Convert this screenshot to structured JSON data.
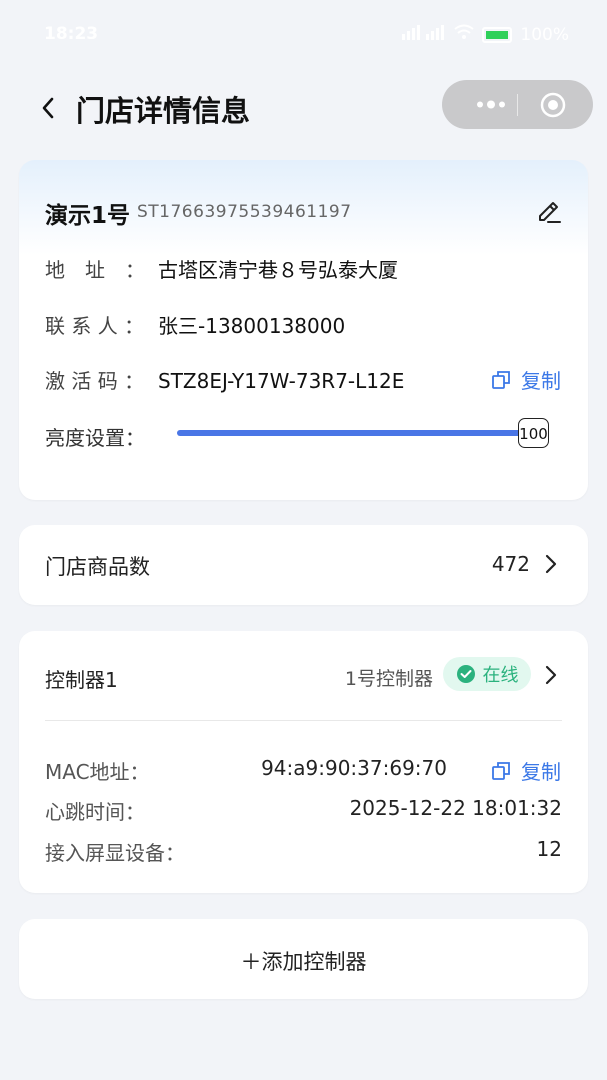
{
  "status_bar": {
    "time": "18:23",
    "battery": "100%"
  },
  "nav": {
    "title": "门店详情信息"
  },
  "store": {
    "name": "演示1号",
    "id": "ST17663975539461197",
    "address_label": "地　址　：",
    "address": "古塔区清宁巷８号弘泰大厦",
    "contact_label": "联 系 人 ：",
    "contact": "张三-13800138000",
    "code_label": "激 活 码 ：",
    "code": "STZ8EJ-Y17W-73R7-L12E",
    "copy_label": "复制",
    "brightness_label": "亮度设置：",
    "brightness_value": 100
  },
  "products": {
    "label": "门店商品数",
    "count": "472"
  },
  "controller": {
    "name": "控制器1",
    "title": "1号控制器",
    "status": "在线",
    "mac_label": "MAC地址：",
    "mac": "94:a9:90:37:69:70",
    "copy_label": "复制",
    "heartbeat_label": "心跳时间：",
    "heartbeat": "2025-12-22 18:01:32",
    "devices_label": "接入屏显设备：",
    "devices": "12"
  },
  "add_controller": {
    "label": "＋添加控制器"
  },
  "colors": {
    "accent": "#4a76e6",
    "online": "#2bb27e",
    "link": "#3b78e7"
  }
}
